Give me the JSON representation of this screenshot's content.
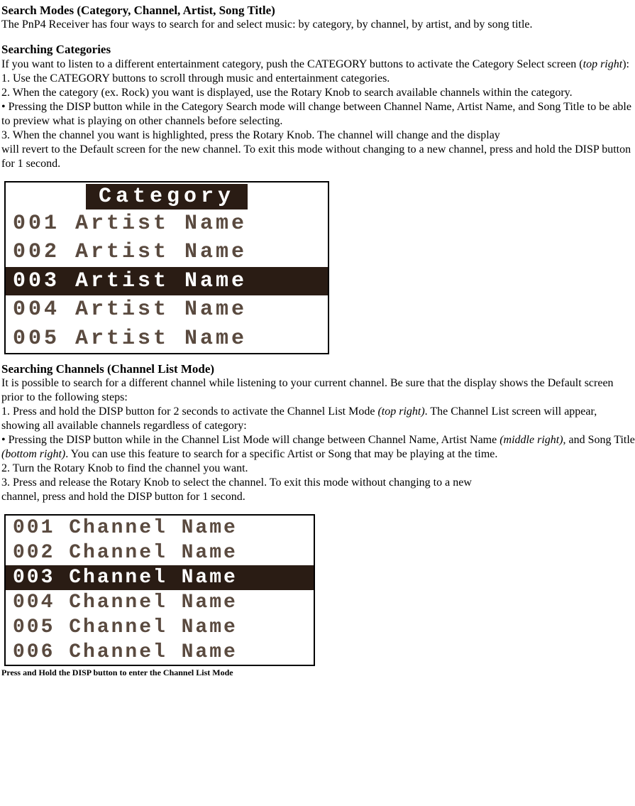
{
  "section1": {
    "heading": "Search Modes (Category, Channel, Artist, Song Title)",
    "intro": "The PnP4 Receiver has four ways to search for and select music: by category, by channel, by artist, and by song title."
  },
  "section2": {
    "heading": "Searching Categories",
    "p1a": "If you want to listen to a different entertainment category, push the CATEGORY buttons to activate the Category Select screen (",
    "p1b": "top right",
    "p1c": "):",
    "li1": "1. Use the CATEGORY buttons to scroll through music and entertainment categories.",
    "li2": "2. When the category (ex. Rock) you want is displayed, use the Rotary Knob to search available channels within the category.",
    "bullet": "• Pressing the DISP button while in the Category Search mode will change between Channel Name, Artist Name, and Song Title to be able to preview what is playing on other channels before selecting.",
    "li3a": "3. When the channel you want is highlighted, press the Rotary Knob. The channel will change and the display",
    "li3b": "will revert to the Default screen for the new channel. To exit this mode without changing to a new channel, press and hold the DISP button for 1 second."
  },
  "lcd1": {
    "header": "Category",
    "rows": [
      {
        "text": "001 Artist Name",
        "selected": false
      },
      {
        "text": "002 Artist Name",
        "selected": false
      },
      {
        "text": "003 Artist Name",
        "selected": true
      },
      {
        "text": "004 Artist Name",
        "selected": false
      },
      {
        "text": "005 Artist Name",
        "selected": false
      }
    ]
  },
  "section3": {
    "heading": "Searching Channels (Channel List Mode)",
    "intro": "It is possible to search for a different channel while listening to your current channel. Be sure that the display shows the Default screen prior to the following steps:",
    "li1a": "1. Press and hold the DISP button for 2 seconds to activate the Channel List Mode ",
    "li1b": "(top right)",
    "li1c": ". The Channel List screen will appear, showing all available channels regardless of category:",
    "bullet_a": "• Pressing the DISP button while in the Channel List Mode will change between Channel Name, Artist Name ",
    "bullet_b": "(middle right)",
    "bullet_c": ", and Song Title ",
    "bullet_d": "(bottom right)",
    "bullet_e": ". You can use this feature to search for a specific Artist or Song that may be playing at the time.",
    "li2": "2. Turn the Rotary Knob to find the channel you want.",
    "li3a": "3. Press and release the Rotary Knob to select the channel. To exit this mode without changing to a new",
    "li3b": "channel, press and hold the DISP button for 1 second."
  },
  "lcd2": {
    "rows": [
      {
        "text": "001 Channel Name",
        "selected": false
      },
      {
        "text": "002 Channel Name",
        "selected": false
      },
      {
        "text": "003 Channel Name",
        "selected": true
      },
      {
        "text": "004 Channel Name",
        "selected": false
      },
      {
        "text": "005 Channel Name",
        "selected": false
      },
      {
        "text": "006 Channel Name",
        "selected": false
      }
    ],
    "caption": "Press and Hold the DISP button to enter the Channel List Mode"
  }
}
